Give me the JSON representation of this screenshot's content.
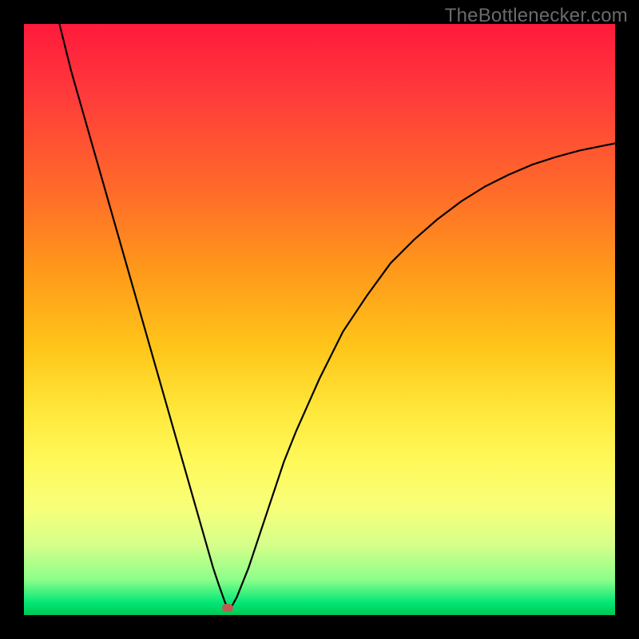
{
  "watermark": {
    "text": "TheBottlenecker.com"
  },
  "chart_data": {
    "type": "line",
    "title": "",
    "xlabel": "",
    "ylabel": "",
    "xlim": [
      0,
      100
    ],
    "ylim": [
      0,
      100
    ],
    "background_gradient": {
      "top": "#ff1a3c",
      "mid": "#ffe63a",
      "bottom": "#00c853"
    },
    "marker": {
      "x": 34.5,
      "y": 1.2,
      "color": "#bf5b55"
    },
    "series": [
      {
        "name": "bottleneck-curve",
        "x": [
          6,
          8,
          10,
          12,
          14,
          16,
          18,
          20,
          22,
          24,
          26,
          28,
          30,
          32,
          33,
          34,
          34.5,
          35,
          36,
          38,
          40,
          42,
          44,
          46,
          50,
          54,
          58,
          62,
          66,
          70,
          74,
          78,
          82,
          86,
          90,
          94,
          98,
          100
        ],
        "y": [
          100,
          92,
          85,
          78,
          71,
          64,
          57,
          50,
          43,
          36,
          29,
          22,
          15,
          8,
          5,
          2.2,
          1.0,
          1.2,
          3,
          8,
          14,
          20,
          26,
          31,
          40,
          48,
          54,
          59.5,
          63.5,
          67,
          70,
          72.5,
          74.5,
          76.2,
          77.5,
          78.6,
          79.4,
          79.8
        ]
      }
    ]
  }
}
